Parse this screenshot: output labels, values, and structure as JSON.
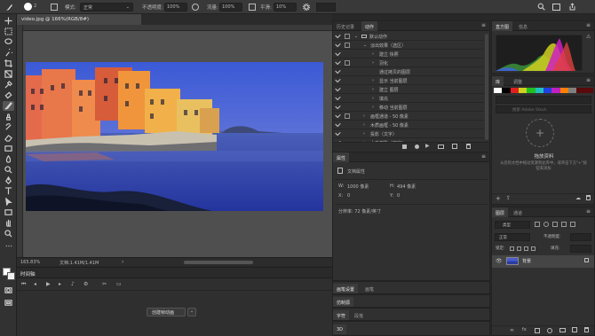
{
  "options": {
    "brush_size": "2",
    "mode_label": "模式:",
    "mode_value": "正常",
    "opacity_label": "不透明度:",
    "opacity_value": "100%",
    "flow_label": "流量:",
    "flow_value": "100%",
    "smoothing_label": "平滑:",
    "smoothing_value": "10%"
  },
  "document": {
    "tab_title": "video.jpg @ 166%(RGB/8#)",
    "zoom": "165.83%",
    "doc_info": "文档:1.41M/1.41M"
  },
  "timeline": {
    "tab": "时间轴",
    "create_button": "创建帧动画"
  },
  "actions_panel": {
    "tabs": [
      "历史记录",
      "动作"
    ],
    "rows": [
      {
        "label": "默认动作",
        "level": 0,
        "check": true,
        "dialog": true,
        "expanded": true,
        "folder": true
      },
      {
        "label": "淡出效果（选区）",
        "level": 1,
        "check": true,
        "dialog": true,
        "expanded": true
      },
      {
        "label": "建立 快照",
        "level": 2,
        "check": true,
        "dialog": false,
        "expanded": false
      },
      {
        "label": "羽化",
        "level": 2,
        "check": true,
        "dialog": true,
        "expanded": false
      },
      {
        "label": "通过拷贝的图层",
        "level": 2,
        "check": true,
        "dialog": false,
        "expanded": null
      },
      {
        "label": "显示 当前图层",
        "level": 2,
        "check": true,
        "dialog": false,
        "expanded": false
      },
      {
        "label": "建立 图层",
        "level": 2,
        "check": true,
        "dialog": false,
        "expanded": false
      },
      {
        "label": "填充",
        "level": 2,
        "check": true,
        "dialog": false,
        "expanded": false
      },
      {
        "label": "移动 当前图层",
        "level": 2,
        "check": true,
        "dialog": false,
        "expanded": false
      },
      {
        "label": "画框通道 - 50 像素",
        "level": 1,
        "check": true,
        "dialog": true,
        "expanded": false
      },
      {
        "label": "木质画框 - 50 像素",
        "level": 1,
        "check": true,
        "dialog": false,
        "expanded": false
      },
      {
        "label": "投影（文字）",
        "level": 1,
        "check": true,
        "dialog": false,
        "expanded": false
      },
      {
        "label": "水中倒影（文字）",
        "level": 1,
        "check": true,
        "dialog": false,
        "expanded": false
      }
    ]
  },
  "properties_panel": {
    "tab": "属性",
    "doc_props_label": "文档属性",
    "w_label": "W:",
    "w_value": "1000 像素",
    "h_label": "H:",
    "h_value": "494 像素",
    "x_label": "X:",
    "x_value": "0",
    "y_label": "Y:",
    "y_value": "0",
    "resolution": "分辨率: 72 像素/英寸"
  },
  "paragraph_panel": {
    "tabs": [
      "画笔设置",
      "画笔"
    ],
    "imitate_tab": "仿制源",
    "char_tabs": [
      "字符",
      "段落"
    ],
    "three_d": "3D"
  },
  "histogram_panel": {
    "tabs": [
      "直方图",
      "信息"
    ]
  },
  "library_panel": {
    "tabs": [
      "库",
      "调整"
    ],
    "swatches_colors": [
      "#ffffff",
      "#000000",
      "#e02020",
      "#d0d020",
      "#20c020",
      "#20c0c0",
      "#2040e0",
      "#c020c0",
      "#ff8000",
      "#808080",
      "#5a0a0a",
      "#5a0a0a"
    ],
    "search_placeholder": "搜索 Adobe Stock",
    "drop_title": "拖放资料",
    "drop_desc": "从您的文档中拖动资源到此库中，或单击下方\"+\"按钮来添加"
  },
  "layers_panel": {
    "tabs": [
      "图层",
      "通道"
    ],
    "filter_kind": "类型",
    "blend_mode": "正常",
    "opacity_label": "不透明度:",
    "lock_label": "锁定:",
    "fill_label": "填充:",
    "layer_name": "背景"
  },
  "colors": {
    "accent": "#4a90d9",
    "sky": "#4a5bd0",
    "sea": "#2a3ca0"
  }
}
